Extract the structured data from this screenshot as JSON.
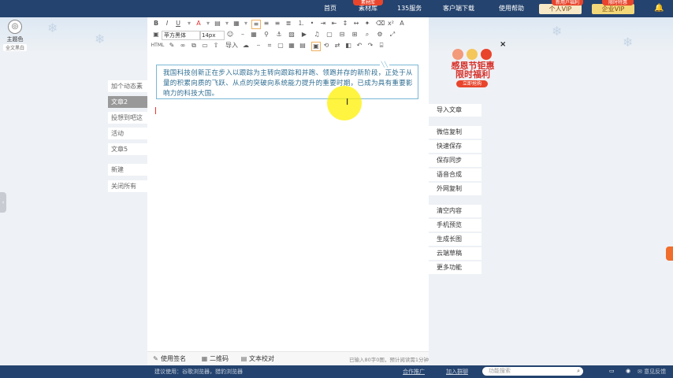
{
  "nav": {
    "items": [
      "首页",
      "素材库",
      "135服务",
      "客户端下载",
      "使用帮助"
    ],
    "badge_material": "素材库",
    "vip_personal": "个人VIP",
    "vip_enterprise": "企业VIP",
    "badge_vip1": "新用户福利",
    "badge_vip2": "限时特惠"
  },
  "theme": {
    "label": "主题色",
    "sub": "全文黑白"
  },
  "tabs": [
    "加个动态素",
    "文章2",
    "投想到吧这",
    "活动",
    "文章5",
    "新建",
    "关闭所有"
  ],
  "toolbar": {
    "font_family": "苹方黑体",
    "font_size": "14px",
    "html_label": "HTML",
    "import_label": "导入"
  },
  "content": {
    "paragraph": "我国科技创新正在步入以跟踪为主转向跟踪和并跑、领跑并存的新阶段，正处于从量的积累向质的飞跃、从点的突破向系统能力提升的重要时期，已成为具有重要影响力的科技大国。",
    "deco": "╲╲"
  },
  "editor_footer": {
    "signature": "使用签名",
    "qrcode": "二维码",
    "proofread": "文本校对",
    "word_count": "已输入80字0图，预计阅读需1分钟"
  },
  "promo": {
    "title": "感恩节钜惠 限时福利",
    "button": "立即抢购"
  },
  "sidebar": {
    "group1": [
      "导入文章"
    ],
    "group2": [
      "微信复制",
      "快速保存",
      "保存同步",
      "语音合成",
      "外网复制"
    ],
    "group3": [
      "清空内容",
      "手机预览",
      "生成长图",
      "云端草稿",
      "更多功能"
    ]
  },
  "bottom": {
    "tip": "建议使用：谷歌浏览器，猎豹浏览器",
    "coop": "合作推广",
    "join": "加入群聊",
    "search_placeholder": "功能搜索",
    "feedback": "意见反馈"
  },
  "colors": {
    "topbar": "#24436e",
    "quote_border": "#7ab7d6",
    "quote_text": "#2f6d92",
    "accent": "#e8452c"
  }
}
